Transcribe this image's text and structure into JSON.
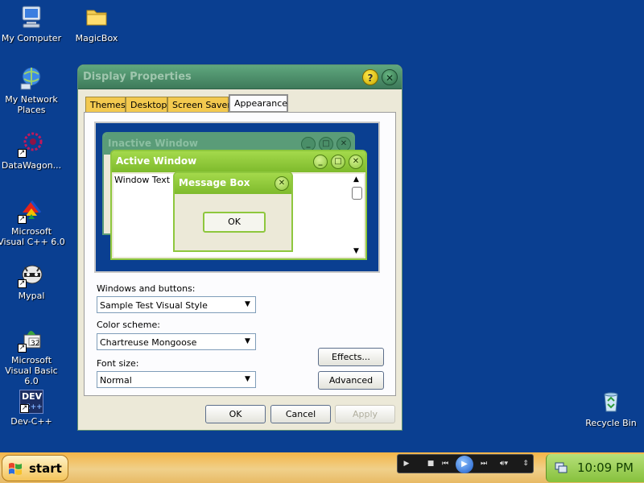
{
  "desktop": {
    "icons": [
      {
        "label": "My Computer",
        "icon": "computer-icon"
      },
      {
        "label": "MagicBox",
        "icon": "folder-icon"
      },
      {
        "label": "My Network Places",
        "icon": "network-icon"
      },
      {
        "label": "DataWagon...",
        "icon": "datawagon-icon"
      },
      {
        "label": "Microsoft Visual C++ 6.0",
        "icon": "visual-cpp-icon"
      },
      {
        "label": "Mypal",
        "icon": "mypal-icon"
      },
      {
        "label": "Microsoft Visual Basic 6.0",
        "icon": "visual-basic-icon"
      },
      {
        "label": "Dev-C++",
        "icon": "dev-cpp-icon"
      },
      {
        "label": "Recycle Bin",
        "icon": "recycle-bin-icon"
      }
    ],
    "dev_icon_text": "DEV",
    "dev_icon_num": "C++",
    "vb_icon_num": "32"
  },
  "dialog": {
    "title": "Display Properties",
    "help_glyph": "?",
    "close_glyph": "✕",
    "tabs": [
      "Themes",
      "Desktop",
      "Screen Saver",
      "Appearance"
    ],
    "active_tab": "Appearance",
    "preview": {
      "inactive_title": "Inactive Window",
      "active_title": "Active Window",
      "window_text": "Window Text",
      "message_title": "Message Box",
      "ok_label": "OK"
    },
    "fields": {
      "windows_buttons_label": "Windows and buttons:",
      "windows_buttons_value": "Sample Test Visual Style",
      "color_scheme_label": "Color scheme:",
      "color_scheme_value": "Chartreuse Mongoose",
      "font_size_label": "Font size:",
      "font_size_value": "Normal"
    },
    "effects_label": "Effects...",
    "advanced_label": "Advanced",
    "ok_label": "OK",
    "cancel_label": "Cancel",
    "apply_label": "Apply"
  },
  "taskbar": {
    "start_label": "start",
    "clock": "10:09 PM"
  },
  "colors": {
    "desktop": "#0a3f91",
    "dialog_title": "#3e7a5a",
    "active_window": "#8ec73d",
    "taskbar": "#f4b548",
    "tray": "#86c03c"
  }
}
